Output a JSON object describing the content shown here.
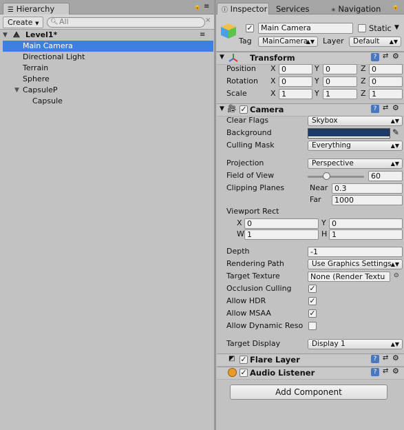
{
  "hierarchy": {
    "tab_label": "Hierarchy",
    "create_label": "Create",
    "search_placeholder": "All",
    "scene_name": "Level1*",
    "items": [
      {
        "label": "Main Camera"
      },
      {
        "label": "Directional Light"
      },
      {
        "label": "Terrain"
      },
      {
        "label": "Sphere"
      },
      {
        "label": "CapsuleP"
      },
      {
        "label": "Capsule"
      }
    ]
  },
  "tabs": {
    "inspector": "Inspector",
    "services": "Services",
    "navigation": "Navigation"
  },
  "object": {
    "name": "Main Camera",
    "static_label": "Static",
    "tag_label": "Tag",
    "tag_value": "MainCamera",
    "layer_label": "Layer",
    "layer_value": "Default"
  },
  "transform": {
    "title": "Transform",
    "rows": [
      {
        "label": "Position",
        "x": "0",
        "y": "0",
        "z": "0"
      },
      {
        "label": "Rotation",
        "x": "0",
        "y": "0",
        "z": "0"
      },
      {
        "label": "Scale",
        "x": "1",
        "y": "1",
        "z": "1"
      }
    ],
    "axis": {
      "x": "X",
      "y": "Y",
      "z": "Z"
    }
  },
  "camera": {
    "title": "Camera",
    "clear_flags_label": "Clear Flags",
    "clear_flags_value": "Skybox",
    "background_label": "Background",
    "background_color": "#1e3a66",
    "culling_mask_label": "Culling Mask",
    "culling_mask_value": "Everything",
    "projection_label": "Projection",
    "projection_value": "Perspective",
    "fov_label": "Field of View",
    "fov_value": "60",
    "fov_fraction": 0.33,
    "clipping_label": "Clipping Planes",
    "near_label": "Near",
    "near_value": "0.3",
    "far_label": "Far",
    "far_value": "1000",
    "viewport_label": "Viewport Rect",
    "vp": {
      "x_label": "X",
      "x": "0",
      "y_label": "Y",
      "y": "0",
      "w_label": "W",
      "w": "1",
      "h_label": "H",
      "h": "1"
    },
    "depth_label": "Depth",
    "depth_value": "-1",
    "rendering_path_label": "Rendering Path",
    "rendering_path_value": "Use Graphics Settings",
    "target_texture_label": "Target Texture",
    "target_texture_value": "None (Render Textu",
    "occlusion_label": "Occlusion Culling",
    "hdr_label": "Allow HDR",
    "msaa_label": "Allow MSAA",
    "dynres_label": "Allow Dynamic Reso",
    "target_display_label": "Target Display",
    "target_display_value": "Display 1"
  },
  "flare": {
    "title": "Flare Layer"
  },
  "audio": {
    "title": "Audio Listener"
  },
  "add_component_label": "Add Component",
  "colors": {
    "selection": "#3d80df",
    "panel": "#c2c2c2"
  }
}
